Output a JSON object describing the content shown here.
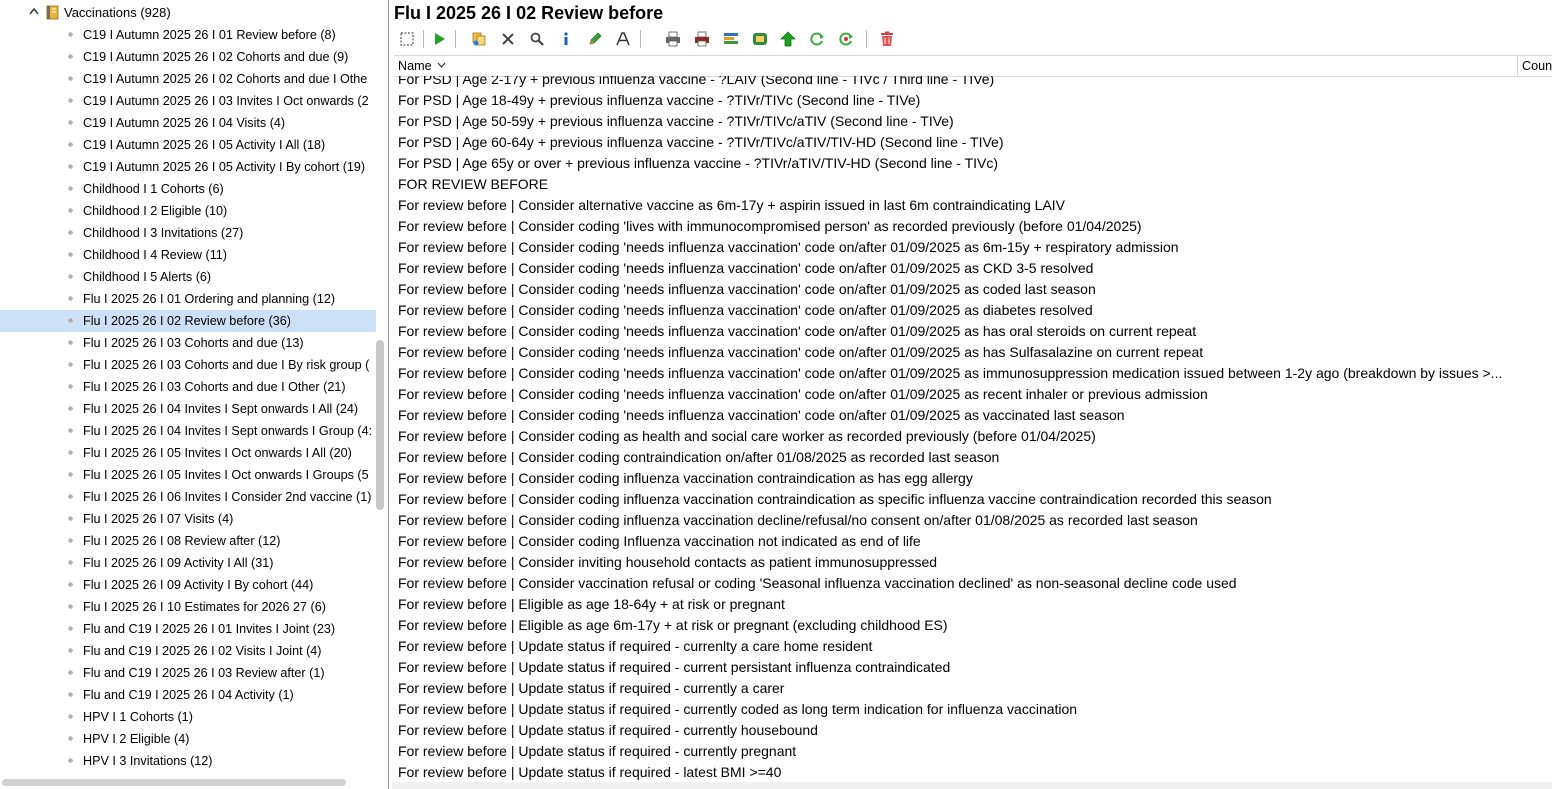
{
  "tree": {
    "root_label": "Vaccinations (928)",
    "items": [
      {
        "label": "C19 I Autumn 2025 26 I 01 Review before (8)",
        "selected": false
      },
      {
        "label": "C19 I Autumn 2025 26 I 02 Cohorts and due (9)",
        "selected": false
      },
      {
        "label": "C19 I Autumn 2025 26 I 02 Cohorts and due I Othe",
        "selected": false
      },
      {
        "label": "C19 I Autumn 2025 26 I 03 Invites I Oct onwards (2",
        "selected": false
      },
      {
        "label": "C19 I Autumn 2025 26 I 04 Visits (4)",
        "selected": false
      },
      {
        "label": "C19 I Autumn 2025 26 I 05 Activity I All (18)",
        "selected": false
      },
      {
        "label": "C19 I Autumn 2025 26 I 05 Activity I By cohort (19)",
        "selected": false
      },
      {
        "label": "Childhood I 1 Cohorts (6)",
        "selected": false
      },
      {
        "label": "Childhood I 2 Eligible (10)",
        "selected": false
      },
      {
        "label": "Childhood I 3 Invitations (27)",
        "selected": false
      },
      {
        "label": "Childhood I 4 Review (11)",
        "selected": false
      },
      {
        "label": "Childhood I 5 Alerts (6)",
        "selected": false
      },
      {
        "label": "Flu I 2025 26 I 01 Ordering and planning (12)",
        "selected": false
      },
      {
        "label": "Flu I 2025 26 I 02 Review before (36)",
        "selected": true
      },
      {
        "label": "Flu I 2025 26 I 03 Cohorts and due (13)",
        "selected": false
      },
      {
        "label": "Flu I 2025 26 I 03 Cohorts and due I By risk group (",
        "selected": false
      },
      {
        "label": "Flu I 2025 26 I 03 Cohorts and due I Other (21)",
        "selected": false
      },
      {
        "label": "Flu I 2025 26 I 04 Invites I Sept onwards I All (24)",
        "selected": false
      },
      {
        "label": "Flu I 2025 26 I 04 Invites I Sept onwards I Group (4:",
        "selected": false
      },
      {
        "label": "Flu I 2025 26 I 05 Invites I Oct onwards I All (20)",
        "selected": false
      },
      {
        "label": "Flu I 2025 26 I 05 Invites I Oct onwards I Groups (5",
        "selected": false
      },
      {
        "label": "Flu I 2025 26 I 06 Invites I Consider 2nd vaccine (1)",
        "selected": false
      },
      {
        "label": "Flu I 2025 26 I 07 Visits (4)",
        "selected": false
      },
      {
        "label": "Flu I 2025 26 I 08 Review after (12)",
        "selected": false
      },
      {
        "label": "Flu I 2025 26 I 09 Activity I All (31)",
        "selected": false
      },
      {
        "label": "Flu I 2025 26 I 09 Activity I By cohort (44)",
        "selected": false
      },
      {
        "label": "Flu I 2025 26 I 10 Estimates for 2026 27 (6)",
        "selected": false
      },
      {
        "label": "Flu and C19 I 2025 26 I 01 Invites I Joint (23)",
        "selected": false
      },
      {
        "label": "Flu and C19 I 2025 26 I 02 Visits I Joint (4)",
        "selected": false
      },
      {
        "label": "Flu and C19 I 2025 26 I 03 Review after (1)",
        "selected": false
      },
      {
        "label": "Flu and C19 I 2025 26 I 04 Activity (1)",
        "selected": false
      },
      {
        "label": "HPV I 1 Cohorts (1)",
        "selected": false
      },
      {
        "label": "HPV I 2 Eligible (4)",
        "selected": false
      },
      {
        "label": "HPV I 3 Invitations (12)",
        "selected": false
      }
    ]
  },
  "report": {
    "title": "Flu I 2025 26 I 02 Review before"
  },
  "toolbar": {
    "buttons": [
      {
        "name": "select-all-icon"
      },
      {
        "name": "run-icon"
      },
      {
        "name": "copy-icon"
      },
      {
        "name": "delete-icon"
      },
      {
        "name": "search-icon"
      },
      {
        "name": "info-icon"
      },
      {
        "name": "edit-icon"
      },
      {
        "name": "rename-icon"
      },
      {
        "name": "print-icon"
      },
      {
        "name": "print-list-icon"
      },
      {
        "name": "export-icon"
      },
      {
        "name": "report-icon"
      },
      {
        "name": "move-up-icon"
      },
      {
        "name": "refresh-icon"
      },
      {
        "name": "refresh-all-icon"
      },
      {
        "name": "trash-icon"
      }
    ]
  },
  "grid": {
    "columns": {
      "name": "Name",
      "count": "Coun"
    },
    "rows": [
      "For PSD | Age  2-17y + previous influenza vaccine - ?LAIV (Second line - TIVc / Third line - TIVe)",
      "For PSD | Age 18-49y + previous influenza vaccine - ?TIVr/TIVc (Second line - TIVe)",
      "For PSD | Age 50-59y + previous influenza vaccine - ?TIVr/TIVc/aTIV (Second line - TIVe)",
      "For PSD | Age 60-64y + previous influenza vaccine - ?TIVr/TIVc/aTIV/TIV-HD (Second line - TIVe)",
      "For PSD | Age 65y or over + previous influenza vaccine - ?TIVr/aTIV/TIV-HD (Second line - TIVc)",
      "FOR REVIEW BEFORE",
      "For review before | Consider alternative vaccine as 6m-17y + aspirin issued in last 6m contraindicating LAIV",
      "For review before | Consider coding 'lives with immunocompromised person' as recorded previously (before 01/04/2025)",
      "For review before | Consider coding 'needs influenza vaccination' code on/after 01/09/2025 as 6m-15y + respiratory admission",
      "For review before | Consider coding 'needs influenza vaccination' code on/after 01/09/2025 as CKD 3-5 resolved",
      "For review before | Consider coding 'needs influenza vaccination' code on/after 01/09/2025 as coded last season",
      "For review before | Consider coding 'needs influenza vaccination' code on/after 01/09/2025 as diabetes resolved",
      "For review before | Consider coding 'needs influenza vaccination' code on/after 01/09/2025 as has oral steroids on current repeat",
      "For review before | Consider coding 'needs influenza vaccination' code on/after 01/09/2025 as has Sulfasalazine on current repeat",
      "For review before | Consider coding 'needs influenza vaccination' code on/after 01/09/2025 as immunosuppression medication issued between 1-2y ago (breakdown by issues >...",
      "For review before | Consider coding 'needs influenza vaccination' code on/after 01/09/2025 as recent inhaler or previous admission",
      "For review before | Consider coding 'needs influenza vaccination' code on/after 01/09/2025 as vaccinated last season",
      "For review before | Consider coding as health and social care worker as recorded previously (before 01/04/2025)",
      "For review before | Consider coding contraindication on/after 01/08/2025 as recorded last season",
      "For review before | Consider coding influenza vaccination contraindication as has egg allergy",
      "For review before | Consider coding influenza vaccination contraindication as specific influenza vaccine contraindication recorded this season",
      "For review before | Consider coding influenza vaccination decline/refusal/no consent on/after 01/08/2025 as recorded last season",
      "For review before | Consider coding Influenza vaccination not indicated as end of life",
      "For review before | Consider inviting household contacts as patient immunosuppressed",
      "For review before | Consider vaccination refusal or coding 'Seasonal influenza vaccination declined' as non-seasonal decline code used",
      "For review before | Eligible as age 18-64y + at risk or pregnant",
      "For review before | Eligible as age 6m-17y + at risk or pregnant (excluding childhood ES)",
      "For review before | Update status if required - currenlty a care home resident",
      "For review before | Update status if required - current persistant influenza contraindicated",
      "For review before | Update status if required - currently a carer",
      "For review before | Update status if required - currently coded as long term indication for influenza vaccination",
      "For review before | Update status if required - currently housebound",
      "For review before | Update status if required - currently pregnant",
      "For review before | Update status if required - latest BMI >=40"
    ]
  }
}
